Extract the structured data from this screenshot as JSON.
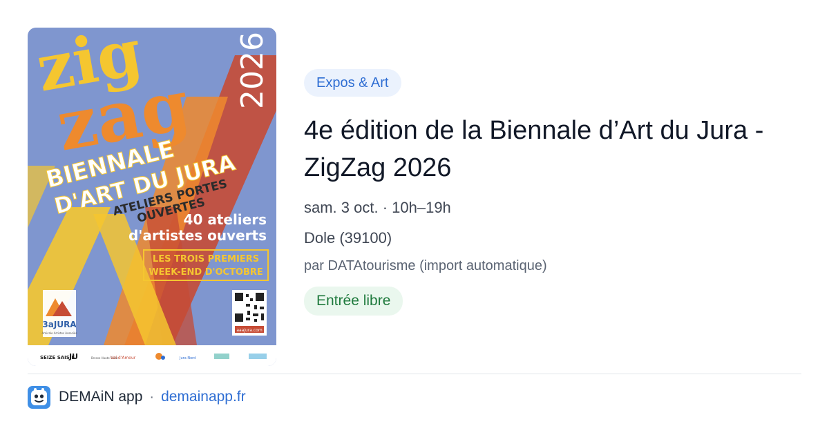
{
  "poster": {
    "title_zig": "zig",
    "title_zag": "zag",
    "year": "2026",
    "line1": "BIENNALE",
    "line2": "D'ART DU JURA",
    "line3": "ATELIERS PORTES",
    "line4": "OUVERTES",
    "ateliers_1": "40 ateliers",
    "ateliers_2": "d'artistes ouverts",
    "box_1": "LES TROIS PREMIERS",
    "box_2": "WEEK-END D'OCTOBRE",
    "logo_text": "3aJURA",
    "logo_sub": "Amicale Artistes Associés",
    "qr_label": "aaajura.com",
    "sponsors": [
      "SEIZE SAISIE",
      "JU",
      "Bresse Haute Seille",
      "Val d'Amour",
      "",
      "Jura Nord",
      "",
      ""
    ]
  },
  "event": {
    "category": "Expos & Art",
    "title": "4e édition de la Biennale d’Art du Jura - ZigZag 2026",
    "datetime": "sam. 3 oct. · 10h–19h",
    "location": "Dole (39100)",
    "source": "par DATAtourisme (import automatique)",
    "price": "Entrée libre"
  },
  "footer": {
    "app_name": "DEMAiN app",
    "separator": "·",
    "domain": "demainapp.fr"
  },
  "colors": {
    "accent": "#2f6ed3",
    "poster_bg": "#7f96cf",
    "poster_orange": "#ee8a2e",
    "poster_yellow": "#f5c630",
    "poster_red": "#c64b35"
  }
}
